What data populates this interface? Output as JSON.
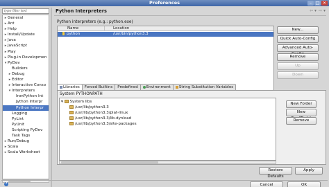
{
  "window": {
    "title": "Preferences",
    "buttons": [
      "–",
      "□",
      "✕"
    ]
  },
  "filter": {
    "placeholder": "type filter text"
  },
  "tree": [
    {
      "label": "General",
      "depth": 0,
      "expandable": true,
      "expanded": false
    },
    {
      "label": "Ant",
      "depth": 0,
      "expandable": true,
      "expanded": false
    },
    {
      "label": "Help",
      "depth": 0,
      "expandable": true,
      "expanded": false
    },
    {
      "label": "Install/Update",
      "depth": 0,
      "expandable": true,
      "expanded": false
    },
    {
      "label": "Java",
      "depth": 0,
      "expandable": true,
      "expanded": false
    },
    {
      "label": "JavaScript",
      "depth": 0,
      "expandable": true,
      "expanded": false
    },
    {
      "label": "Play",
      "depth": 0,
      "expandable": true,
      "expanded": false
    },
    {
      "label": "Plug-in Developmen",
      "depth": 0,
      "expandable": true,
      "expanded": false
    },
    {
      "label": "PyDev",
      "depth": 0,
      "expandable": true,
      "expanded": true
    },
    {
      "label": "Builders",
      "depth": 1,
      "expandable": false
    },
    {
      "label": "Debug",
      "depth": 1,
      "expandable": true,
      "expanded": false
    },
    {
      "label": "Editor",
      "depth": 1,
      "expandable": true,
      "expanded": false
    },
    {
      "label": "Interactive Conso",
      "depth": 1,
      "expandable": true,
      "expanded": false
    },
    {
      "label": "Interpreters",
      "depth": 1,
      "expandable": true,
      "expanded": true
    },
    {
      "label": "IronPython Int",
      "depth": 2,
      "expandable": false
    },
    {
      "label": "Jython Interpr",
      "depth": 2,
      "expandable": false
    },
    {
      "label": "Python Interpr",
      "depth": 2,
      "expandable": false,
      "selected": true
    },
    {
      "label": "Logging",
      "depth": 1,
      "expandable": false
    },
    {
      "label": "PyLint",
      "depth": 1,
      "expandable": false
    },
    {
      "label": "PyUnit",
      "depth": 1,
      "expandable": false
    },
    {
      "label": "Scripting PyDev",
      "depth": 1,
      "expandable": false
    },
    {
      "label": "Task Tags",
      "depth": 1,
      "expandable": false
    },
    {
      "label": "Run/Debug",
      "depth": 0,
      "expandable": true,
      "expanded": false
    },
    {
      "label": "Scala",
      "depth": 0,
      "expandable": true,
      "expanded": false
    },
    {
      "label": "Scala Worksheet",
      "depth": 0,
      "expandable": true,
      "expanded": false
    }
  ],
  "page": {
    "title": "Python Interpreters",
    "nav": [
      "⇦ ▾",
      "⇨ ▾"
    ],
    "interpreters_label": "Python interpreters (e.g.: python.exe)",
    "columns": {
      "name": "Name",
      "location": "Location"
    },
    "interpreter": {
      "name": "python",
      "location": "/usr/bin/python3.3"
    },
    "interp_buttons": [
      "New...",
      "Quick Auto-Config",
      "Advanced Auto-Config",
      "Remove",
      "Up",
      "Down"
    ],
    "tabs": [
      "Libraries",
      "Forced Builtins",
      "Predefined",
      "Environment",
      "String Substitution Variables"
    ],
    "system_pythonpath": "System PYTHONPATH",
    "libs_root": "System libs",
    "libs": [
      "/usr/lib/python3.3",
      "/usr/lib/python3.3/plat-linux",
      "/usr/lib/python3.3/lib-dynload",
      "/usr/lib/python3.3/site-packages"
    ],
    "lib_buttons": [
      "New Folder",
      "New Egg/Zip(s)",
      "Remove"
    ],
    "bottom_buttons": [
      "Restore Defaults",
      "Apply"
    ],
    "dialog_buttons": [
      "Cancel",
      "OK"
    ]
  },
  "colors": {
    "selection": "#4a76c2",
    "titlebar": "#3f66a8"
  }
}
